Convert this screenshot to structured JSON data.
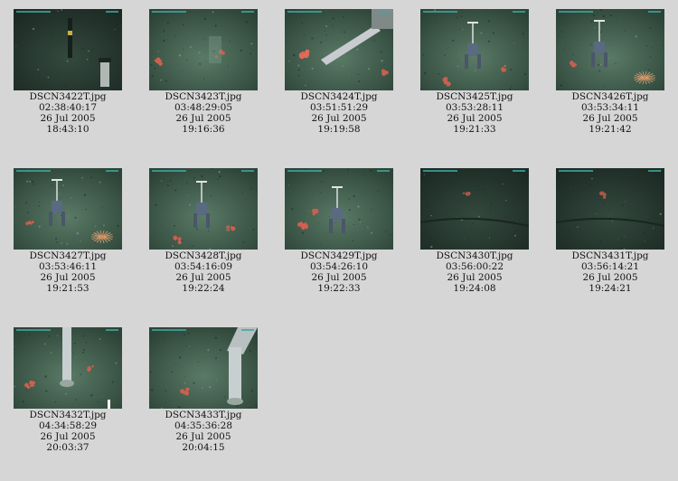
{
  "thumbnails": [
    {
      "file": "DSCN3422T.jpg",
      "elapsed": "02:38:40:17",
      "date": "26 Jul 2005",
      "time": "18:43:10",
      "scene": "pole-dark"
    },
    {
      "file": "DSCN3423T.jpg",
      "elapsed": "03:48:29:05",
      "date": "26 Jul 2005",
      "time": "19:16:36",
      "scene": "seafloor-coral"
    },
    {
      "file": "DSCN3424T.jpg",
      "elapsed": "03:51:51:29",
      "date": "26 Jul 2005",
      "time": "19:19:58",
      "scene": "arm-coral"
    },
    {
      "file": "DSCN3425T.jpg",
      "elapsed": "03:53:28:11",
      "date": "26 Jul 2005",
      "time": "19:21:33",
      "scene": "instrument"
    },
    {
      "file": "DSCN3426T.jpg",
      "elapsed": "03:53:34:11",
      "date": "26 Jul 2005",
      "time": "19:21:42",
      "scene": "instrument-star"
    },
    {
      "file": "DSCN3427T.jpg",
      "elapsed": "03:53:46:11",
      "date": "26 Jul 2005",
      "time": "19:21:53",
      "scene": "instrument-star"
    },
    {
      "file": "DSCN3428T.jpg",
      "elapsed": "03:54:16:09",
      "date": "26 Jul 2005",
      "time": "19:22:24",
      "scene": "instrument"
    },
    {
      "file": "DSCN3429T.jpg",
      "elapsed": "03:54:26:10",
      "date": "26 Jul 2005",
      "time": "19:22:33",
      "scene": "instrument-coral"
    },
    {
      "file": "DSCN3430T.jpg",
      "elapsed": "03:56:00:22",
      "date": "26 Jul 2005",
      "time": "19:24:08",
      "scene": "seafloor-dark"
    },
    {
      "file": "DSCN3431T.jpg",
      "elapsed": "03:56:14:21",
      "date": "26 Jul 2005",
      "time": "19:24:21",
      "scene": "seafloor-dark"
    },
    {
      "file": "DSCN3432T.jpg",
      "elapsed": "04:34:58:29",
      "date": "26 Jul 2005",
      "time": "20:03:37",
      "scene": "core-tube"
    },
    {
      "file": "DSCN3433T.jpg",
      "elapsed": "04:35:36:28",
      "date": "26 Jul 2005",
      "time": "20:04:15",
      "scene": "core-tube-arm"
    }
  ]
}
